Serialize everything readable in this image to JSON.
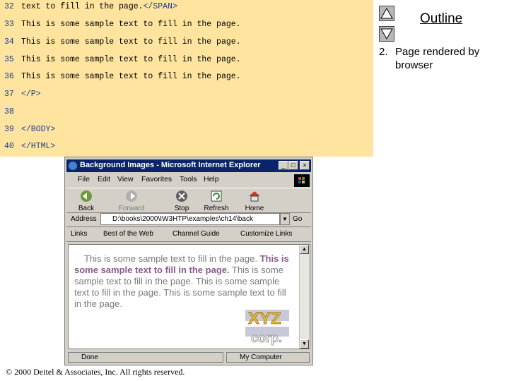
{
  "code": {
    "lines": [
      {
        "num": "32",
        "pre": "text to fill in the page.",
        "tag": "</SPAN>"
      },
      {
        "num": "33",
        "pre": "This is some sample text to fill in the page.",
        "tag": ""
      },
      {
        "num": "34",
        "pre": "This is some sample text to fill in the page.",
        "tag": ""
      },
      {
        "num": "35",
        "pre": "This is some sample text to fill in the page.",
        "tag": ""
      },
      {
        "num": "36",
        "pre": "This is some sample text to fill in the page.",
        "tag": ""
      },
      {
        "num": "37",
        "pre": "",
        "tag": "</P>"
      },
      {
        "num": "38",
        "pre": "",
        "tag": ""
      },
      {
        "num": "39",
        "pre": "",
        "tag": "</BODY>"
      },
      {
        "num": "40",
        "pre": "",
        "tag": "</HTML>"
      }
    ]
  },
  "outline": {
    "title": "Outline",
    "item_number": "2.",
    "item_text": "Page rendered by browser"
  },
  "browser": {
    "title": "Background Images - Microsoft Internet Explorer",
    "menu": [
      "File",
      "Edit",
      "View",
      "Favorites",
      "Tools",
      "Help"
    ],
    "toolbar": [
      "Back",
      "Forward",
      "Stop",
      "Refresh",
      "Home"
    ],
    "address_label": "Address",
    "address_value": "D:\\books\\2000\\IW3HTP\\examples\\ch14\\back",
    "go_label": "Go",
    "links_label": "Links",
    "links": [
      "Best of the Web",
      "Channel Guide",
      "Customize Links"
    ],
    "content_plain_1": "This is some sample text to fill in the page.",
    "content_bold_1": "This is some sample text to fill in the page.",
    "content_plain_2": "This is some sample text to fill in the page. This is some sample text to fill in the page. This is some sample text to fill in the page.",
    "status": "Done",
    "zone": "My Computer",
    "logo_text": "XYZ corp."
  },
  "footer": {
    "copyright": "© 2000 Deitel & Associates, Inc. All rights reserved."
  }
}
